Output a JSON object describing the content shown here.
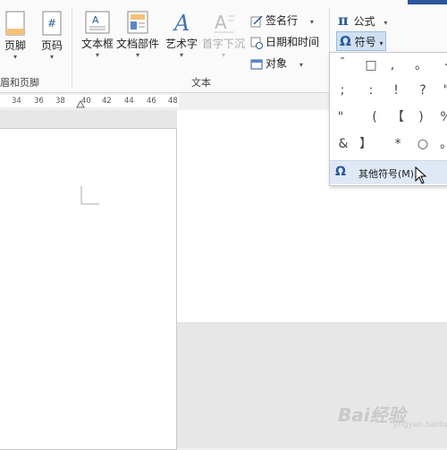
{
  "ribbon": {
    "header_footer_group": {
      "footer_label": "页脚",
      "page_number_label": "页码",
      "group_label": "眉和页脚"
    },
    "text_group": {
      "textbox_label": "文本框",
      "quickparts_label": "文档部件",
      "wordart_label": "艺术字",
      "dropcap_label": "首字下沉",
      "signature_label": "签名行",
      "datetime_label": "日期和时间",
      "object_label": "对象",
      "group_label": "文本"
    },
    "symbols_group": {
      "equation_label": "公式",
      "symbol_label": "符号"
    }
  },
  "ruler": {
    "ticks": [
      "34",
      "36",
      "38",
      "40",
      "42",
      "44",
      "46",
      "48"
    ]
  },
  "symbol_menu": {
    "rows": [
      [
        "¯",
        "□",
        ",",
        "。",
        "·"
      ],
      [
        ";",
        ":",
        "!",
        "?",
        "\""
      ],
      [
        "\"",
        "(",
        "【",
        ")",
        "%"
      ],
      [
        "&",
        "】",
        "*",
        "○",
        "。"
      ]
    ],
    "more_symbols_label": "其他符号(M)..."
  },
  "watermark": {
    "text": "Bai经验",
    "sub": "jingyan.baidu.com"
  },
  "colors": {
    "accent": "#2a5a9a",
    "menu_highlight": "#dfe9f5",
    "ribbon_bg": "#fafafa"
  }
}
